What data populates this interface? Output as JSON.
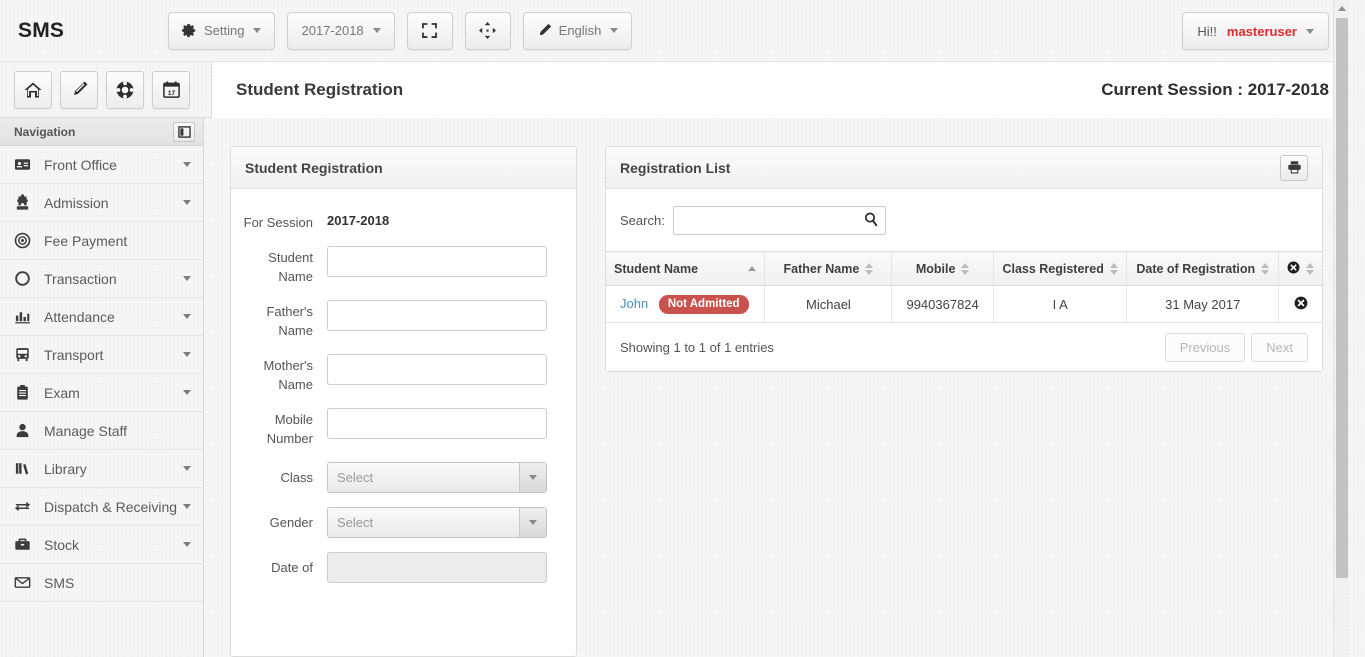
{
  "topbar": {
    "brand": "SMS",
    "setting_label": "Setting",
    "session_label": "2017-2018",
    "fullscreen_label": "fullscreen-icon",
    "resize_label": "resize-icon",
    "language_label": "English",
    "greeting": "Hi!!",
    "username": "masteruser"
  },
  "iconrail": {
    "home": "home-icon",
    "edit": "pencil-icon",
    "support": "lifebuoy-icon",
    "calendar": "calendar-icon",
    "calendar_day": "17"
  },
  "pagehead": {
    "title": "Student Registration",
    "session": "Current Session : 2017-2018"
  },
  "sidebar": {
    "heading": "Navigation",
    "collapse_icon": "sidebar-collapse-icon",
    "items": [
      {
        "label": "Front Office",
        "icon": "id-card-icon",
        "caret": true
      },
      {
        "label": "Admission",
        "icon": "puzzle-icon",
        "caret": true
      },
      {
        "label": "Fee Payment",
        "icon": "target-icon",
        "caret": false
      },
      {
        "label": "Transaction",
        "icon": "circle-icon",
        "caret": true
      },
      {
        "label": "Attendance",
        "icon": "bar-chart-icon",
        "caret": true
      },
      {
        "label": "Transport",
        "icon": "bus-icon",
        "caret": true
      },
      {
        "label": "Exam",
        "icon": "clipboard-icon",
        "caret": true
      },
      {
        "label": "Manage Staff",
        "icon": "user-icon",
        "caret": false
      },
      {
        "label": "Library",
        "icon": "books-icon",
        "caret": true
      },
      {
        "label": "Dispatch & Receiving",
        "icon": "exchange-icon",
        "caret": true
      },
      {
        "label": "Stock",
        "icon": "briefcase-icon",
        "caret": true
      },
      {
        "label": "SMS",
        "icon": "envelope-icon",
        "caret": false
      }
    ]
  },
  "form": {
    "title": "Student Registration",
    "session_label": "For Session",
    "session_value": "2017-2018",
    "student_name_label": "Student Name",
    "student_name_value": "",
    "father_name_label": "Father's Name",
    "father_name_value": "",
    "mother_name_label": "Mother's Name",
    "mother_name_value": "",
    "mobile_label": "Mobile Number",
    "mobile_value": "",
    "class_label": "Class",
    "class_value": "Select",
    "gender_label": "Gender",
    "gender_value": "Select",
    "dob_label": "Date of",
    "dob_value": ""
  },
  "list": {
    "title": "Registration List",
    "print_icon": "printer-icon",
    "search_label": "Search:",
    "search_value": "",
    "search_placeholder": "",
    "search_icon": "search-icon",
    "columns": [
      {
        "label": "Student Name",
        "sort": "asc"
      },
      {
        "label": "Father Name",
        "sort": "none"
      },
      {
        "label": "Mobile",
        "sort": "none"
      },
      {
        "label": "Class Registered",
        "sort": "none"
      },
      {
        "label": "Date of Registration",
        "sort": "none"
      },
      {
        "label": "delete-icon",
        "sort": "none"
      }
    ],
    "rows": [
      {
        "student_name": "John",
        "status_badge": "Not Admitted",
        "father_name": "Michael",
        "mobile": "9940367824",
        "class_registered": "I A",
        "date_of_registration": "31 May 2017",
        "action": "delete-icon"
      }
    ],
    "footer_info": "Showing 1 to 1 of 1 entries",
    "previous_label": "Previous",
    "next_label": "Next"
  },
  "colors": {
    "badge_red": "#c9524f",
    "link_blue": "#4a90b8",
    "username_red": "#dd2b2b"
  }
}
